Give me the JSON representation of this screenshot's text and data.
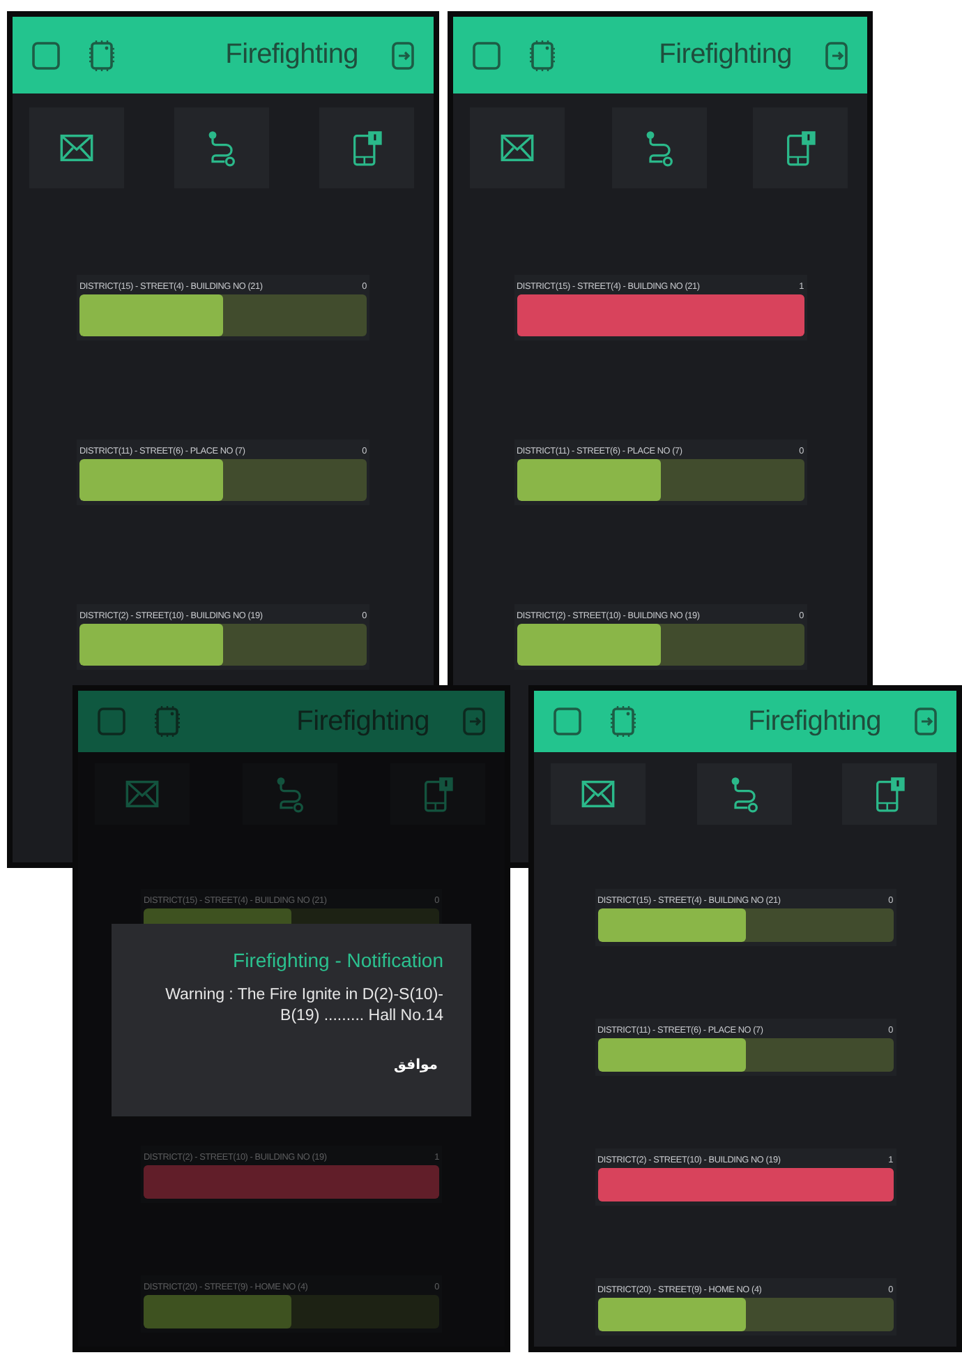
{
  "screens": [
    {
      "title": "Firefighting",
      "dimmed": false,
      "rows": [
        {
          "label": "DISTRICT(15) - STREET(4) - BUILDING NO (21)",
          "value": "0",
          "on": false,
          "level": 0.5
        },
        {
          "label": "DISTRICT(11) - STREET(6) - PLACE NO (7)",
          "value": "0",
          "on": false,
          "level": 0.5
        },
        {
          "label": "DISTRICT(2) - STREET(10) - BUILDING NO (19)",
          "value": "0",
          "on": false,
          "level": 0.5
        }
      ]
    },
    {
      "title": "Firefighting",
      "dimmed": false,
      "rows": [
        {
          "label": "DISTRICT(15) - STREET(4) - BUILDING NO (21)",
          "value": "1",
          "on": true,
          "level": 1
        },
        {
          "label": "DISTRICT(11) - STREET(6) - PLACE NO (7)",
          "value": "0",
          "on": false,
          "level": 0.5
        },
        {
          "label": "DISTRICT(2) - STREET(10) - BUILDING NO (19)",
          "value": "0",
          "on": false,
          "level": 0.5
        }
      ]
    },
    {
      "title": "Firefighting",
      "dimmed": true,
      "rows": [
        {
          "label": "DISTRICT(15) - STREET(4) - BUILDING NO (21)",
          "value": "0",
          "on": false,
          "level": 0.5
        },
        {
          "label": "DISTRICT(2) - STREET(10) - BUILDING NO (19)",
          "value": "1",
          "on": true,
          "level": 1
        },
        {
          "label": "DISTRICT(20) - STREET(9) - HOME NO (4)",
          "value": "0",
          "on": false,
          "level": 0.5
        }
      ],
      "dialog": {
        "title": "Firefighting - Notification",
        "message": "Warning : The Fire Ignite in D(2)-S(10)-B(19) ......... Hall No.14",
        "button": "موافق"
      }
    },
    {
      "title": "Firefighting",
      "dimmed": false,
      "rows": [
        {
          "label": "DISTRICT(15) - STREET(4) - BUILDING NO (21)",
          "value": "0",
          "on": false,
          "level": 0.5
        },
        {
          "label": "DISTRICT(11) - STREET(6) - PLACE NO (7)",
          "value": "0",
          "on": false,
          "level": 0.5
        },
        {
          "label": "DISTRICT(2) - STREET(10) - BUILDING NO (19)",
          "value": "1",
          "on": true,
          "level": 1
        },
        {
          "label": "DISTRICT(20) - STREET(9) - HOME NO (4)",
          "value": "0",
          "on": false,
          "level": 0.5
        }
      ]
    }
  ]
}
